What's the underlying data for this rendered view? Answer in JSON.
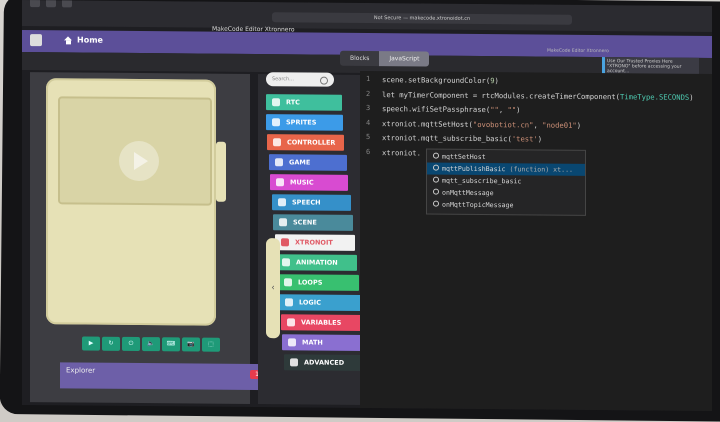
{
  "browser": {
    "address": "Not Secure — makecode.xtronoidot.cn",
    "window_title": "MakeCode Editor Xtronnero"
  },
  "header": {
    "home_label": "Home"
  },
  "editor_tabs": [
    {
      "label": "Blocks"
    },
    {
      "label": "JavaScript"
    }
  ],
  "notification": {
    "heading": "MakeCode Editor Xtronnero",
    "text": "Use Our Trusted Proxies Here \"XTRONO\" before accessing your account..."
  },
  "toolbox": {
    "search_placeholder": "Search...",
    "categories": [
      {
        "label": "RTC",
        "color": "#3fbf9d"
      },
      {
        "label": "SPRITES",
        "color": "#3c9be8"
      },
      {
        "label": "CONTROLLER",
        "color": "#e8654a"
      },
      {
        "label": "GAME",
        "color": "#4d6fd0"
      },
      {
        "label": "MUSIC",
        "color": "#d84bd1"
      },
      {
        "label": "SPEECH",
        "color": "#3590c9"
      },
      {
        "label": "SCENE",
        "color": "#4a8a9b"
      },
      {
        "label": "XTRONOIT",
        "color": "#f2f2f2"
      },
      {
        "label": "ANIMATION",
        "color": "#40c08b"
      },
      {
        "label": "LOOPS",
        "color": "#38c070"
      },
      {
        "label": "LOGIC",
        "color": "#3aa0ce"
      },
      {
        "label": "VARIABLES",
        "color": "#e84763"
      },
      {
        "label": "MATH",
        "color": "#8a6fd1"
      },
      {
        "label": "ADVANCED",
        "color": "#2e3a3a"
      }
    ]
  },
  "simulator": {
    "buttons": [
      "▶",
      "↻",
      "⏻",
      "🔈",
      "⌨",
      "📷",
      "⬚"
    ]
  },
  "explorer": {
    "label": "Explorer",
    "count": "1"
  },
  "code": {
    "line_numbers": [
      "1",
      "2",
      "3",
      "4",
      "5",
      "6"
    ],
    "lines": [
      "scene.setBackgroundColor(9)",
      "let myTimerComponent = rtcModules.createTimerComponent(TimeType.SECONDS)",
      "speech.wifiSetPassphrase(\"\", \"\")",
      "xtroniot.mqttSetHost(\"ovobotiot.cn\", \"node01\")",
      "xtroniot.mqtt_subscribe_basic('test')",
      "xtroniot."
    ]
  },
  "autocomplete": [
    {
      "label": "mqttSetHost",
      "detail": ""
    },
    {
      "label": "mqttPublishBasic",
      "detail": "(function) xt..."
    },
    {
      "label": "mqtt_subscribe_basic",
      "detail": ""
    },
    {
      "label": "onMqttMessage",
      "detail": ""
    },
    {
      "label": "onMqttTopicMessage",
      "detail": ""
    }
  ]
}
